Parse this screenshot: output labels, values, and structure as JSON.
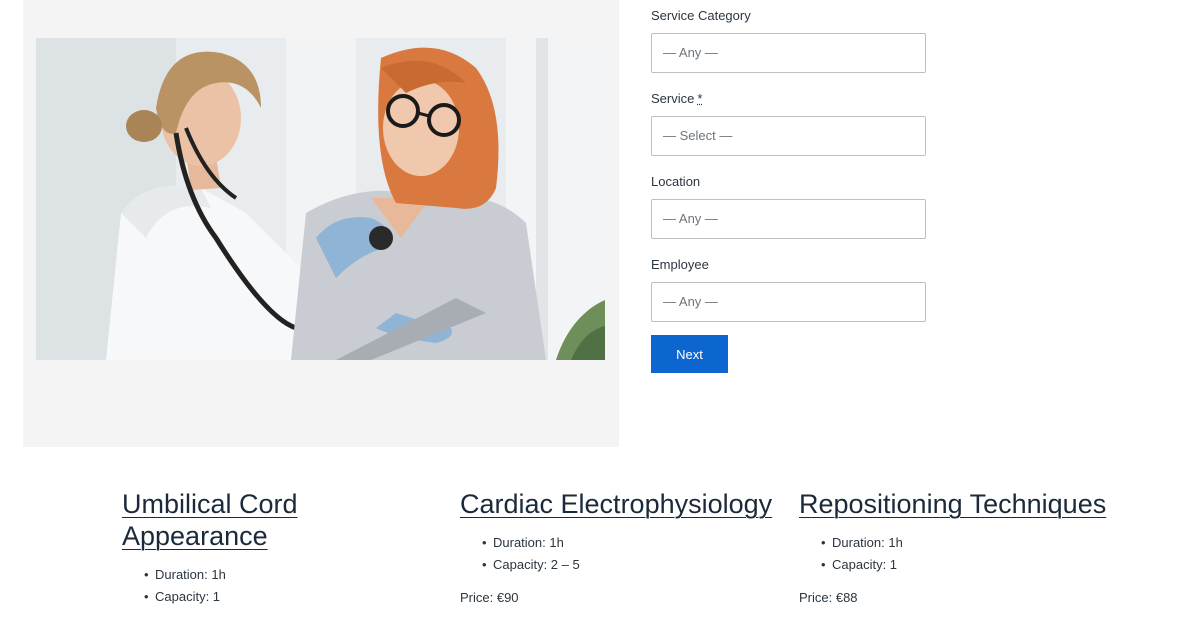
{
  "form": {
    "fields": [
      {
        "label": "Service Category",
        "value": "— Any —",
        "required": false
      },
      {
        "label": "Service",
        "value": "— Select —",
        "required": true,
        "required_mark": "*"
      },
      {
        "label": "Location",
        "value": "— Any —",
        "required": false
      },
      {
        "label": "Employee",
        "value": "— Any —",
        "required": false
      }
    ],
    "next_label": "Next"
  },
  "services": [
    {
      "title": "Umbilical Cord Appearance",
      "duration": "Duration: 1h",
      "capacity": "Capacity: 1",
      "price": ""
    },
    {
      "title": "Cardiac Electrophysiology",
      "duration": "Duration: 1h",
      "capacity": "Capacity: 2 – 5",
      "price": "Price: €90"
    },
    {
      "title": "Repositioning Techniques",
      "duration": "Duration: 1h",
      "capacity": "Capacity: 1",
      "price": "Price: €88"
    }
  ],
  "colors": {
    "accent": "#0d66d0",
    "panel_bg": "#f4f4f4",
    "text": "#1f2a33"
  },
  "icons": {
    "hero": "photo-doctor-patient"
  }
}
